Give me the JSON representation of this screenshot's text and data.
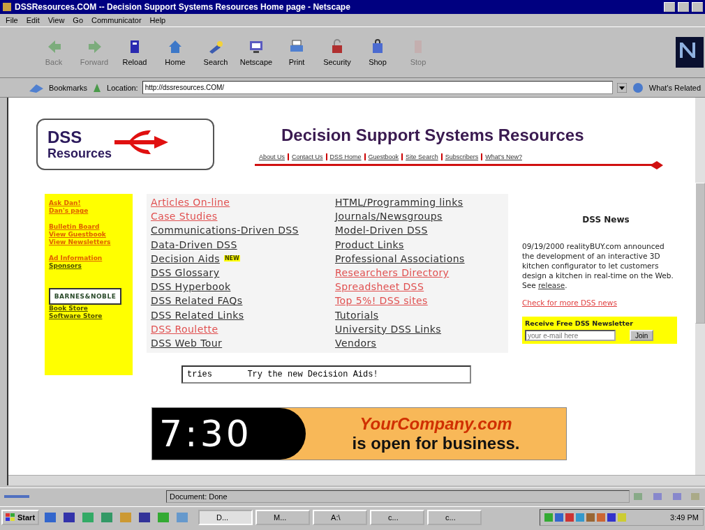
{
  "window": {
    "title": "DSSResources.COM -- Decision Support Systems Resources Home page - Netscape"
  },
  "menu": [
    "File",
    "Edit",
    "View",
    "Go",
    "Communicator",
    "Help"
  ],
  "toolbar": [
    {
      "label": "Back",
      "disabled": true
    },
    {
      "label": "Forward",
      "disabled": true
    },
    {
      "label": "Reload",
      "disabled": false
    },
    {
      "label": "Home",
      "disabled": false
    },
    {
      "label": "Search",
      "disabled": false
    },
    {
      "label": "Netscape",
      "disabled": false
    },
    {
      "label": "Print",
      "disabled": false
    },
    {
      "label": "Security",
      "disabled": false
    },
    {
      "label": "Shop",
      "disabled": false
    },
    {
      "label": "Stop",
      "disabled": true
    }
  ],
  "location_bar": {
    "bookmarks": "Bookmarks",
    "label": "Location:",
    "url": "http://dssresources.COM/",
    "related": "What's Related"
  },
  "page": {
    "logo": {
      "line1": "DSS",
      "line2": "Resources"
    },
    "heading": "Decision Support Systems Resources",
    "nav": [
      "About Us",
      "Contact Us",
      "DSS Home",
      "Guestbook",
      "Site Search",
      "Subscribers",
      "What's New?"
    ],
    "sidebar_groups": [
      [
        {
          "label": "Ask Dan!",
          "visited": false
        },
        {
          "label": "Dan's page",
          "visited": false
        }
      ],
      [
        {
          "label": "Bulletin Board",
          "visited": false
        },
        {
          "label": "View Guestbook",
          "visited": false
        },
        {
          "label": "View Newsletters",
          "visited": false
        }
      ],
      [
        {
          "label": "Ad Information",
          "visited": false
        },
        {
          "label": "Sponsors",
          "visited": true
        }
      ]
    ],
    "bookseller_badge": "BARNES&NOBLE",
    "store_links": [
      {
        "label": "Book Store",
        "visited": true
      },
      {
        "label": "Software Store",
        "visited": true
      }
    ],
    "links_col1": [
      {
        "label": "Articles On-line",
        "visited": true
      },
      {
        "label": "Case Studies",
        "visited": true
      },
      {
        "label": "Communications-Driven DSS",
        "visited": false
      },
      {
        "label": "Data-Driven DSS",
        "visited": false
      },
      {
        "label": "Decision Aids",
        "visited": false,
        "badge": "NEW"
      },
      {
        "label": "DSS Glossary",
        "visited": false
      },
      {
        "label": "DSS Hyperbook",
        "visited": false
      },
      {
        "label": "DSS Related FAQs",
        "visited": false
      },
      {
        "label": "DSS Related Links",
        "visited": false
      },
      {
        "label": "DSS Roulette",
        "visited": true
      },
      {
        "label": "DSS Web Tour",
        "visited": false
      }
    ],
    "links_col2": [
      {
        "label": "HTML/Programming links",
        "visited": false
      },
      {
        "label": "Journals/Newsgroups",
        "visited": false
      },
      {
        "label": "Model-Driven DSS",
        "visited": false
      },
      {
        "label": "Product Links",
        "visited": false
      },
      {
        "label": "Professional Associations",
        "visited": false
      },
      {
        "label": "Researchers Directory",
        "visited": true
      },
      {
        "label": "Spreadsheet DSS",
        "visited": true
      },
      {
        "label": "Top 5%! DSS sites",
        "visited": true
      },
      {
        "label": "Tutorials",
        "visited": false
      },
      {
        "label": "University DSS Links",
        "visited": false
      },
      {
        "label": "Vendors",
        "visited": false
      }
    ],
    "news": {
      "title": "DSS News",
      "text": "09/19/2000 realityBUY.com announced the development of an interactive 3D kitchen configurator to let customers design a kitchen in real-time on the Web. See",
      "link": "release",
      "link_suffix": ".",
      "more": "Check for more DSS news"
    },
    "newsletter": {
      "title": "Receive Free DSS Newsletter",
      "placeholder": "your e-mail here",
      "button": "Join"
    },
    "ticker": "tries       Try the new Decision Aids!",
    "banner": {
      "time": [
        "7",
        ":",
        "3",
        "0"
      ],
      "brand": "YourCompany.com",
      "tagline": "is open for business."
    }
  },
  "status_bar": {
    "text": "Document: Done"
  },
  "taskbar": {
    "start": "Start",
    "tasks": [
      {
        "label": "D...",
        "selected": true
      },
      {
        "label": "M...",
        "selected": false
      },
      {
        "label": "A:\\",
        "selected": false
      },
      {
        "label": "c...",
        "selected": false
      },
      {
        "label": "c...",
        "selected": false
      }
    ],
    "clock": "3:49 PM"
  }
}
